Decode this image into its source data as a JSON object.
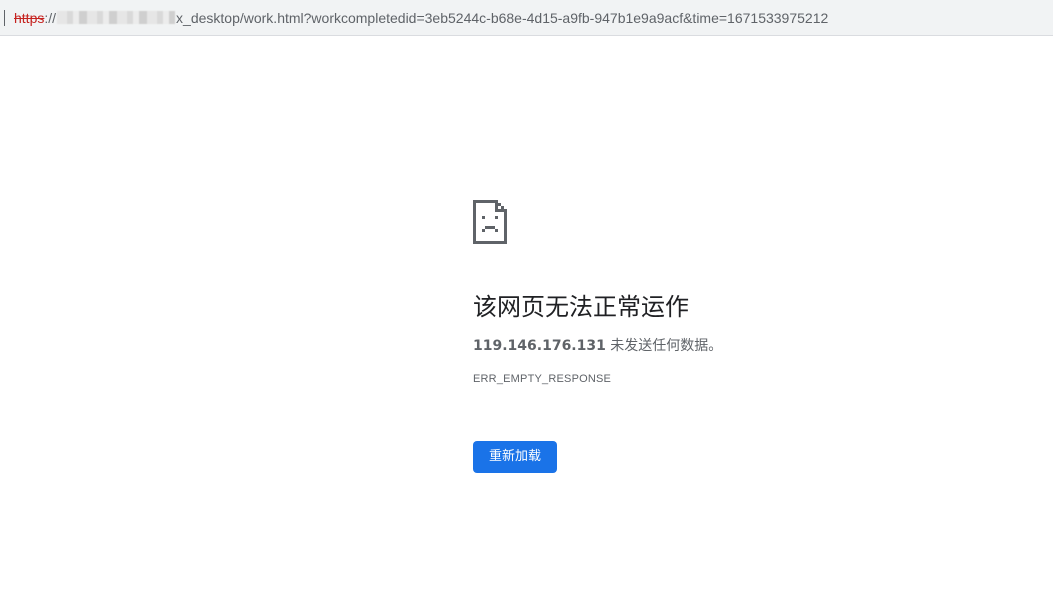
{
  "address_bar": {
    "scheme": "https",
    "separator": "://",
    "path": "x_desktop/work.html?workcompletedid=3eb5244c-b68e-4d15-a9fb-947b1e9a9acf&time=1671533975212"
  },
  "error_page": {
    "icon": "sad-page-icon",
    "title": "该网页无法正常运作",
    "host": "119.146.176.131",
    "message_suffix": " 未发送任何数据。",
    "error_code": "ERR_EMPTY_RESPONSE",
    "reload_label": "重新加载"
  },
  "colors": {
    "button": "#1a73e8",
    "insecure_scheme": "#c5221f",
    "text_primary": "#202124",
    "text_secondary": "#5f6368"
  }
}
